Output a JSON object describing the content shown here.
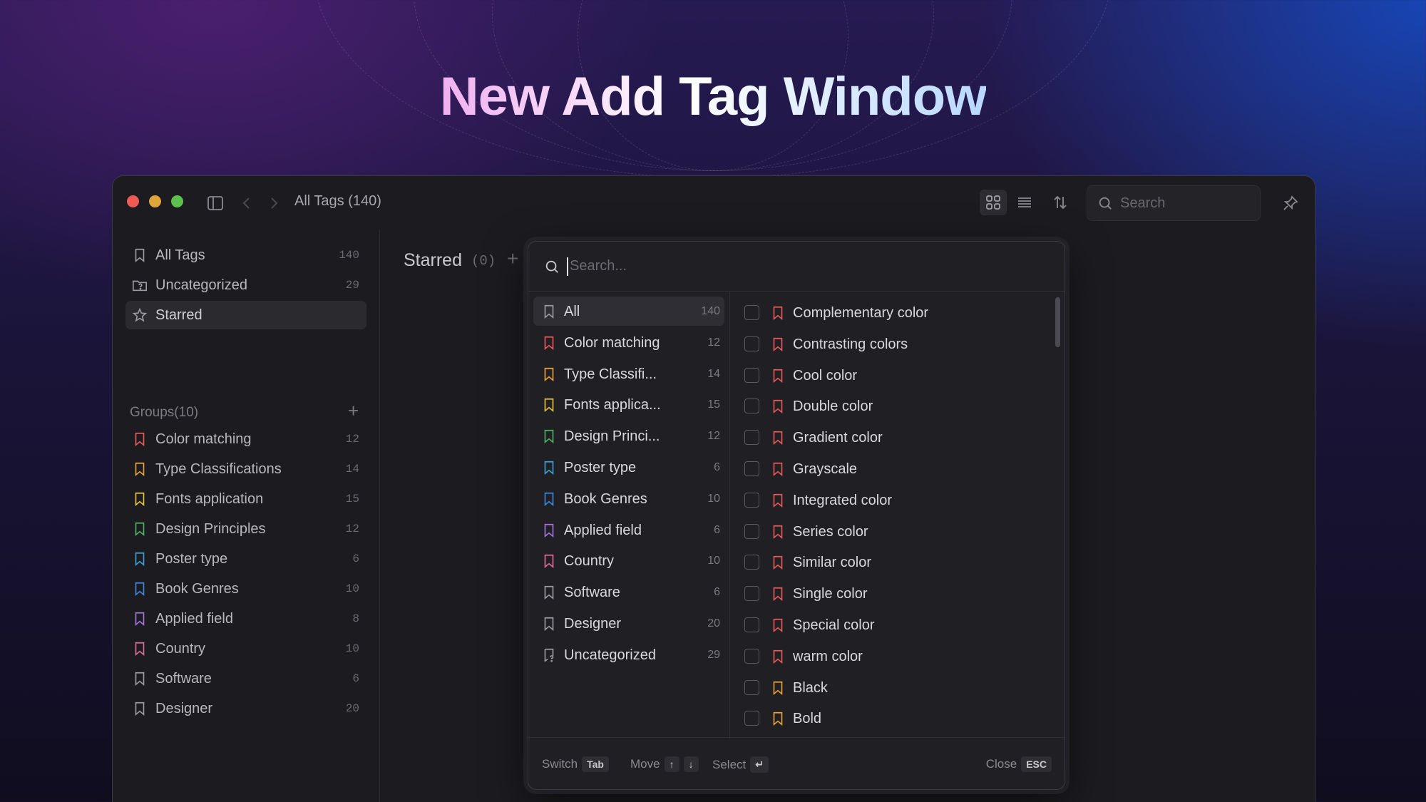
{
  "headline": "New Add Tag Window",
  "colors": {
    "red": "#e8595a",
    "orange": "#e8a23a",
    "yellow": "#e6c23a",
    "green": "#4fb063",
    "teal": "#3d9fd6",
    "blue": "#3e86e0",
    "purple": "#a474d8",
    "pink": "#e06a9a",
    "gray": "#9a9aa2"
  },
  "titlebar": {
    "title": "All Tags (140)",
    "search_placeholder": "Search"
  },
  "sidebar": {
    "top_items": [
      {
        "label": "All Tags",
        "count": "140",
        "icon": "bookmark-icon"
      },
      {
        "label": "Uncategorized",
        "count": "29",
        "icon": "folder-question-icon"
      },
      {
        "label": "Starred",
        "count": "",
        "icon": "star-icon"
      }
    ],
    "groups_label": "Groups(10)",
    "groups": [
      {
        "label": "Color matching",
        "count": "12",
        "color": "red"
      },
      {
        "label": "Type Classifications",
        "count": "14",
        "color": "orange"
      },
      {
        "label": "Fonts application",
        "count": "15",
        "color": "yellow"
      },
      {
        "label": "Design Principles",
        "count": "12",
        "color": "green"
      },
      {
        "label": "Poster type",
        "count": "6",
        "color": "teal"
      },
      {
        "label": "Book Genres",
        "count": "10",
        "color": "blue"
      },
      {
        "label": "Applied field",
        "count": "8",
        "color": "purple"
      },
      {
        "label": "Country",
        "count": "10",
        "color": "pink"
      },
      {
        "label": "Software",
        "count": "6",
        "color": "gray"
      },
      {
        "label": "Designer",
        "count": "20",
        "color": "gray"
      }
    ]
  },
  "content": {
    "title": "Starred",
    "count": "(0)"
  },
  "popup": {
    "search_placeholder": "Search...",
    "categories": [
      {
        "label": "All",
        "count": "140",
        "color": "gray"
      },
      {
        "label": "Color matching",
        "count": "12",
        "color": "red"
      },
      {
        "label": "Type Classifi...",
        "count": "14",
        "color": "orange"
      },
      {
        "label": "Fonts applica...",
        "count": "15",
        "color": "yellow"
      },
      {
        "label": "Design Princi...",
        "count": "12",
        "color": "green"
      },
      {
        "label": "Poster type",
        "count": "6",
        "color": "teal"
      },
      {
        "label": "Book Genres",
        "count": "10",
        "color": "blue"
      },
      {
        "label": "Applied field",
        "count": "6",
        "color": "purple"
      },
      {
        "label": "Country",
        "count": "10",
        "color": "pink"
      },
      {
        "label": "Software",
        "count": "6",
        "color": "gray"
      },
      {
        "label": "Designer",
        "count": "20",
        "color": "gray"
      },
      {
        "label": "Uncategorized",
        "count": "29",
        "color": "gray"
      }
    ],
    "tags": [
      {
        "label": "Complementary color",
        "color": "red"
      },
      {
        "label": "Contrasting colors",
        "color": "red"
      },
      {
        "label": "Cool color",
        "color": "red"
      },
      {
        "label": "Double color",
        "color": "red"
      },
      {
        "label": "Gradient color",
        "color": "red"
      },
      {
        "label": "Grayscale",
        "color": "red"
      },
      {
        "label": "Integrated color",
        "color": "red"
      },
      {
        "label": "Series color",
        "color": "red"
      },
      {
        "label": "Similar color",
        "color": "red"
      },
      {
        "label": "Single color",
        "color": "red"
      },
      {
        "label": "Special color",
        "color": "red"
      },
      {
        "label": "warm color",
        "color": "red"
      },
      {
        "label": "Black",
        "color": "orange"
      },
      {
        "label": "Bold",
        "color": "orange"
      }
    ],
    "footer": {
      "switch_label": "Switch",
      "switch_key": "Tab",
      "move_label": "Move",
      "move_up_key": "↑",
      "move_down_key": "↓",
      "select_label": "Select",
      "select_key": "↵",
      "close_label": "Close",
      "close_key": "ESC"
    }
  }
}
